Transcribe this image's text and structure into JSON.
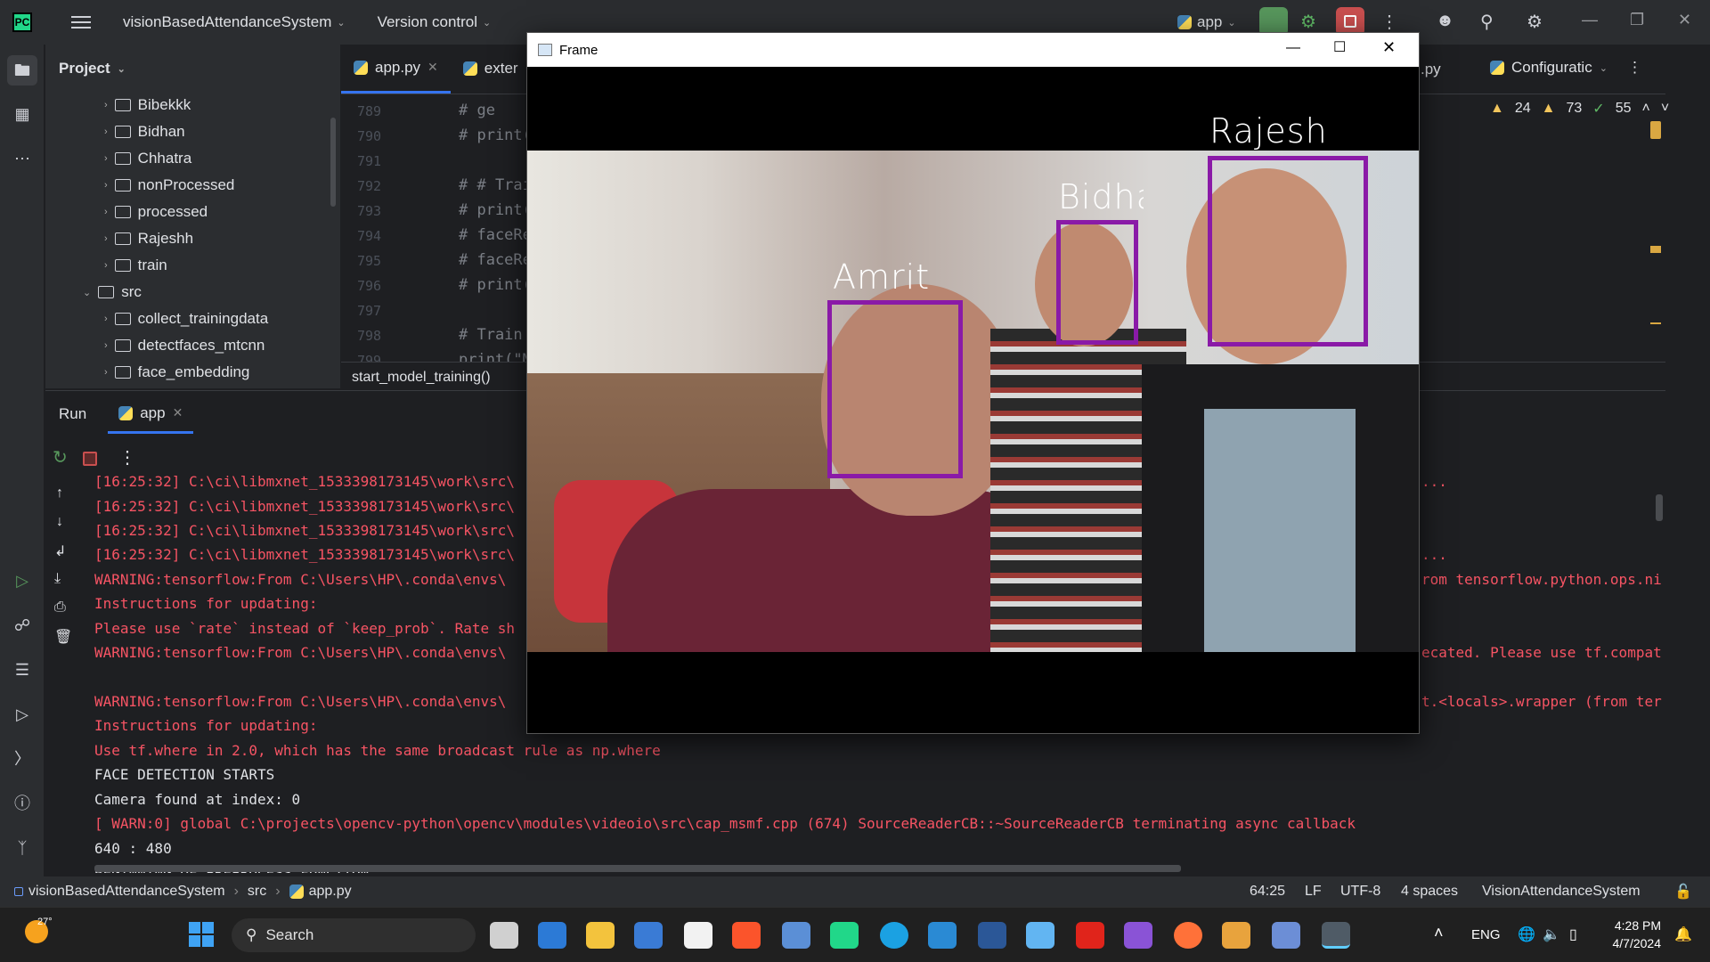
{
  "titlebar": {
    "project_name": "visionBasedAttendanceSystem",
    "version_control": "Version control",
    "run_config": "app"
  },
  "project": {
    "header": "Project",
    "tree": [
      "Bibekkk",
      "Bidhan",
      "Chhatra",
      "nonProcessed",
      "processed",
      "Rajeshh",
      "train",
      "src",
      "collect_trainingdata",
      "detectfaces_mtcnn",
      "face_embedding"
    ]
  },
  "editor": {
    "tabs": [
      "app.py",
      "exter",
      ".py",
      "Configuratic"
    ],
    "inspections": {
      "warn1": "24",
      "warn2": "73",
      "ok": "55"
    },
    "lines": [
      {
        "n": "789",
        "t": "#     ge"
      },
      {
        "n": "790",
        "t": "# print("
      },
      {
        "n": "791",
        "t": ""
      },
      {
        "n": "792",
        "t": "# # Trai"
      },
      {
        "n": "793",
        "t": "# print("
      },
      {
        "n": "794",
        "t": "# faceRe"
      },
      {
        "n": "795",
        "t": "# faceRe"
      },
      {
        "n": "796",
        "t": "# print("
      },
      {
        "n": "797",
        "t": ""
      },
      {
        "n": "798",
        "t": "# Train "
      },
      {
        "n": "799",
        "t": "print(\"M"
      }
    ],
    "breadcrumb": "start_model_training()"
  },
  "run": {
    "title": "Run",
    "tab": "app",
    "lines": [
      {
        "t": "[16:25:32] C:\\ci\\libmxnet_1533398173145\\work\\src\\",
        "c": "err",
        "r": "..."
      },
      {
        "t": "[16:25:32] C:\\ci\\libmxnet_1533398173145\\work\\src\\",
        "c": "err",
        "r": ""
      },
      {
        "t": "[16:25:32] C:\\ci\\libmxnet_1533398173145\\work\\src\\",
        "c": "err",
        "r": ""
      },
      {
        "t": "[16:25:32] C:\\ci\\libmxnet_1533398173145\\work\\src\\",
        "c": "err",
        "r": "..."
      },
      {
        "t": "WARNING:tensorflow:From C:\\Users\\HP\\.conda\\envs\\",
        "c": "err",
        "r": "rom tensorflow.python.ops.ni"
      },
      {
        "t": "Instructions for updating:",
        "c": "err",
        "r": ""
      },
      {
        "t": "Please use `rate` instead of `keep_prob`. Rate sh",
        "c": "err",
        "r": ""
      },
      {
        "t": "WARNING:tensorflow:From C:\\Users\\HP\\.conda\\envs\\",
        "c": "err",
        "r": "ecated. Please use tf.compat"
      },
      {
        "t": "",
        "c": "err",
        "r": ""
      },
      {
        "t": "WARNING:tensorflow:From C:\\Users\\HP\\.conda\\envs\\",
        "c": "err",
        "r": "t.<locals>.wrapper (from ter"
      },
      {
        "t": "Instructions for updating:",
        "c": "err",
        "r": ""
      },
      {
        "t": "Use tf.where in 2.0, which has the same broadcast rule as np.where",
        "c": "err",
        "r": ""
      },
      {
        "t": "FACE DETECTION STARTS",
        "c": "ok",
        "r": ""
      },
      {
        "t": "Camera found at index: 0",
        "c": "ok",
        "r": ""
      },
      {
        "t": "[ WARN:0] global C:\\projects\\opencv-python\\opencv\\modules\\videoio\\src\\cap_msmf.cpp (674) SourceReaderCB::~SourceReaderCB terminating async callback",
        "c": "err",
        "r": ""
      },
      {
        "t": "640 : 480",
        "c": "ok",
        "r": ""
      },
      {
        "t": "BEGINNING OF PREPROCESS FUNCTION",
        "c": "ok",
        "r": ""
      }
    ]
  },
  "statusbar": {
    "project": "visionBasedAttendanceSystem",
    "src": "src",
    "file": "app.py",
    "pos": "64:25",
    "lf": "LF",
    "enc": "UTF-8",
    "indent": "4 spaces",
    "interp": "VisionAttendanceSystem"
  },
  "frame": {
    "title": "Frame",
    "faces": [
      "Amrit",
      "Bidhan",
      "Rajesh"
    ]
  },
  "taskbar": {
    "weather": "27°",
    "search": "Search",
    "lang": "ENG",
    "time": "4:28 PM",
    "date": "4/7/2024"
  }
}
